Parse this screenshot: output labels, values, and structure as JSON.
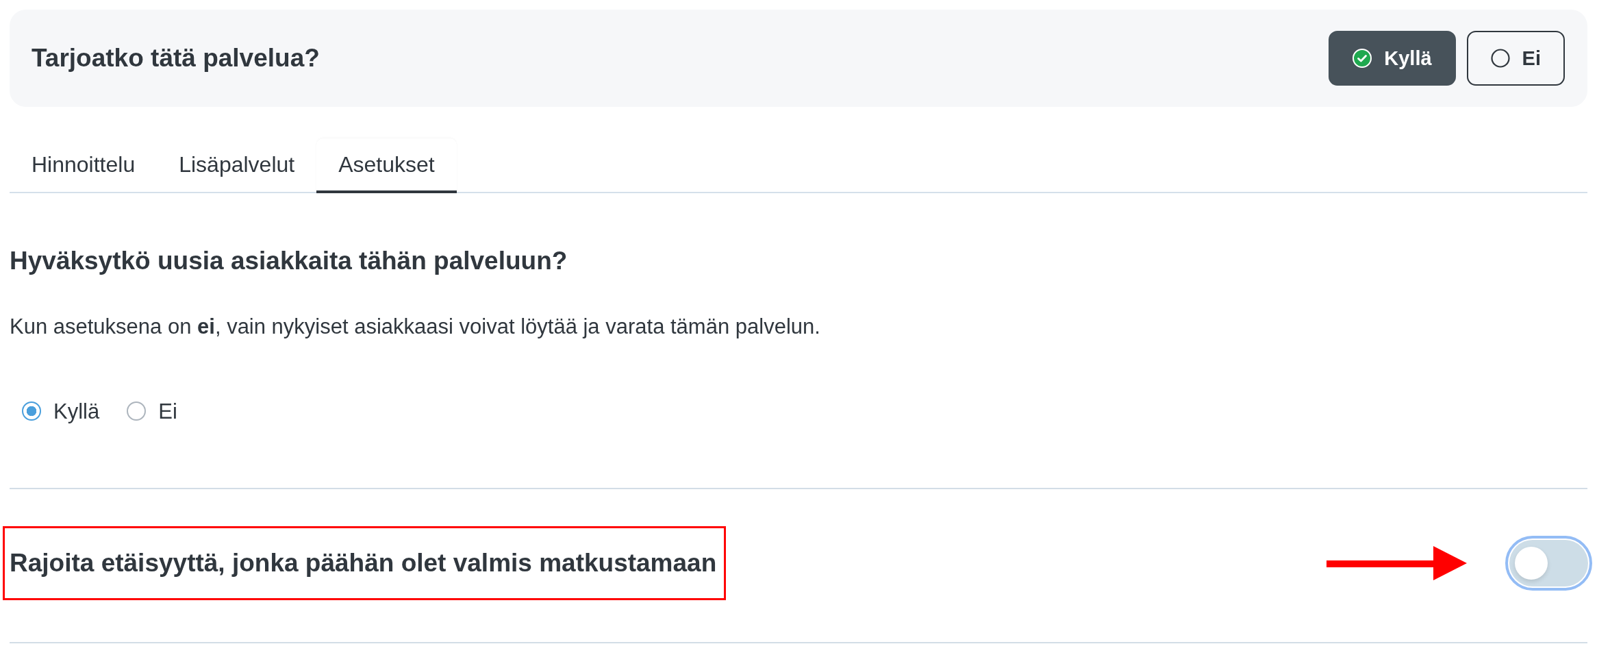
{
  "offer_panel": {
    "question": "Tarjoatko tätä palvelua?",
    "options": [
      {
        "label": "Kyllä",
        "selected": true
      },
      {
        "label": "Ei",
        "selected": false
      }
    ]
  },
  "tabs": [
    {
      "label": "Hinnoittelu",
      "selected": false
    },
    {
      "label": "Lisäpalvelut",
      "selected": false
    },
    {
      "label": "Asetukset",
      "selected": true
    }
  ],
  "new_customers": {
    "title": "Hyväksytkö uusia asiakkaita tähän palveluun?",
    "description": "Kun asetuksena on **ei**, vain nykyiset asiakkaasi voivat löytää ja varata tämän palvelun.",
    "options": [
      {
        "label": "Kyllä",
        "selected": true
      },
      {
        "label": "Ei",
        "selected": false
      }
    ]
  },
  "distance_limit": {
    "title": "Rajoita etäisyyttä, jonka päähän olet valmis matkustamaan",
    "highlighted": true,
    "pointer_arrow": true,
    "switch": {
      "on": false,
      "focused": true
    }
  }
}
